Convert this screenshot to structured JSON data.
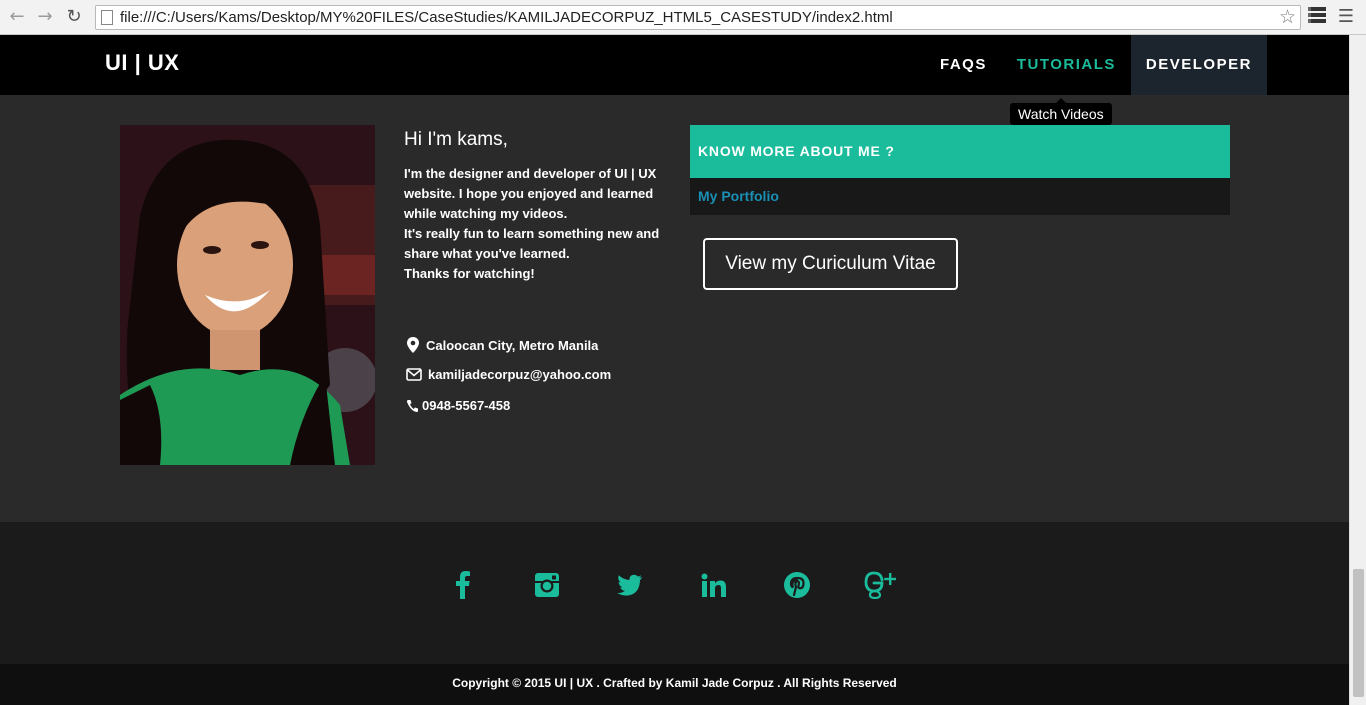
{
  "browser": {
    "url": "file:///C:/Users/Kams/Desktop/MY%20FILES/CaseStudies/KAMILJADECORPUZ_HTML5_CASESTUDY/index2.html"
  },
  "header": {
    "logo": "UI | UX",
    "nav": [
      {
        "label": "FAQS"
      },
      {
        "label": "TUTORIALS"
      },
      {
        "label": "DEVELOPER"
      }
    ],
    "tooltip": "Watch Videos"
  },
  "profile": {
    "greeting": "Hi I'm kams,",
    "bio_lines": [
      "I'm the designer and developer of UI | UX website. I hope you enjoyed and learned while watching my videos.",
      "It's really fun to learn something new and share what you've learned.",
      "Thanks for watching!"
    ],
    "location": "Caloocan City, Metro Manila",
    "email": "kamiljadecorpuz@yahoo.com",
    "phone": "0948-5567-458"
  },
  "about": {
    "heading": "KNOW MORE ABOUT ME ?",
    "link": "My Portfolio",
    "cv_button": "View my Curiculum Vitae"
  },
  "footer": {
    "social_icons": [
      "facebook-icon",
      "instagram-icon",
      "twitter-icon",
      "linkedin-icon",
      "pinterest-icon",
      "google-plus-icon"
    ],
    "copyright": "Copyright © 2015 UI | UX . Crafted by Kamil Jade Corpuz . All Rights Reserved"
  },
  "colors": {
    "accent": "#1abc9c",
    "background": "#2a2a2a",
    "header": "#000000",
    "link": "#1a8fb5"
  }
}
